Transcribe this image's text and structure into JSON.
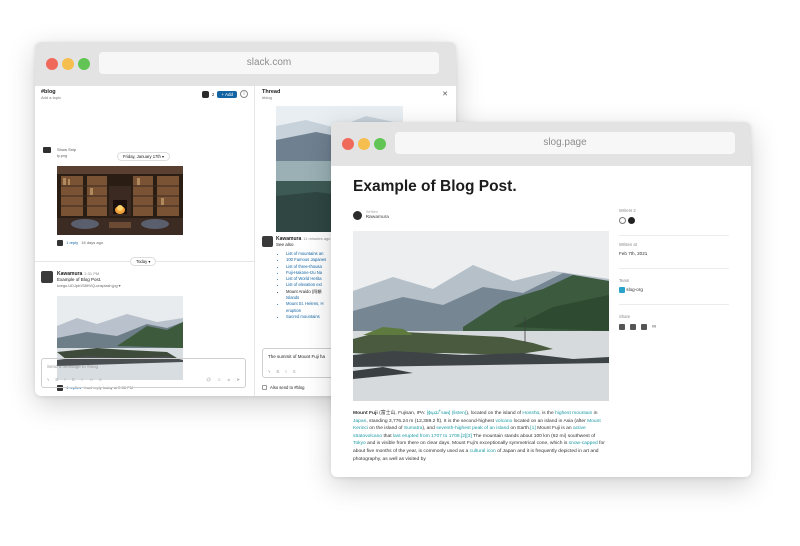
{
  "slack_window": {
    "url": "slack.com",
    "channel": {
      "name": "#blog",
      "topic": "Add a topic",
      "member_count": "2",
      "add_label": "+ Add"
    },
    "messages": {
      "prev_snippet": "Show Snip",
      "prev_file": "ty.png",
      "day_divider_1": "Friday, January 17th",
      "reply_1": "1 reply",
      "reply_1_time": "16 days ago",
      "day_divider_2": "Today",
      "kawamura": {
        "user": "Kawamura",
        "time": "2:31 PM",
        "text": "Example of Blog Post.",
        "file": "kvegu-UDJpb1S8HVQ-unsplash.jpg",
        "replies": "4 replies",
        "last_reply": "Last reply today at 2:38 PM"
      }
    },
    "composer_placeholder": "Send a message to #blog",
    "thread": {
      "title": "Thread",
      "channel": "#blog",
      "reply_user": "Kawamura",
      "reply_time": "11 minutes ago",
      "see_also": "See also",
      "items": [
        "List of mountains an",
        "100 Famous Japanes",
        "List of three-thousa",
        "Fuji-Hakone-Izu Na",
        "List of World Herita",
        "List of elevation ext",
        "Mount Araido (阿頼",
        "Islands",
        "Mount St. Helens, H",
        "eruption",
        "Sacred mountains"
      ],
      "composer_text": "The summit of Mount Fuji ha",
      "also_send": "Also send to #blog"
    }
  },
  "blog_window": {
    "url": "slog.page",
    "title": "Example of Blog Post.",
    "author_label": "Written by",
    "author_name": "Kawamura",
    "body": {
      "p1": "Mount Fuji",
      "p1_jp": " (富士山, Fujisan, IPA: ",
      "ipa": "[ɸɯ̥ʑiꜜsaɴ] (listen)",
      "p1b": "), located on the island of ",
      "honshu": "Honshū",
      "p1c": ", is the ",
      "highest_mountain": "highest mountain",
      "p1d": " in ",
      "japan": "Japan",
      "p1e": ", standing 3,776.24 m (12,389.2 ft). It is the second-highest ",
      "volcano": "volcano",
      "p1f": " located on an island in Asia (after ",
      "kerinci": "Mount Kerinci",
      "p1g": " on the island of ",
      "sumatra": "Sumatra",
      "p1h": "), and ",
      "seventh": "seventh-highest peak of an island",
      "p1i": " on Earth.",
      "ref1": "[1]",
      "p1j": " Mount Fuji is an ",
      "active": "active stratovolcano",
      "p1k": " that ",
      "erupted": "last erupted from 1707 to 1708",
      "refs": ".[2][3]",
      "p1l": " The mountain stands about 100 km (62 mi) southwest of ",
      "tokyo": "Tokyo",
      "p1m": " and is visible from there on clear days. Mount Fuji's exceptionally symmetrical cone, which is ",
      "snow": "snow-capped",
      "p1n": " for about five months of the year, is commonly used as a ",
      "cultural": "cultural icon",
      "p1o": " of Japan and it is frequently depicted in art and photography, as well as visited by"
    },
    "sidebar": {
      "writers_label": "Writers",
      "writers_count": "2",
      "written_at_label": "Written at",
      "written_at": "Feb 7th, 2021",
      "team_label": "Team",
      "team": "slog-org",
      "share_label": "Share"
    }
  },
  "colors": {
    "link_slack": "#1264a3",
    "link_blog": "#1a9aa3",
    "dot_red": "#ef6a5a",
    "dot_yellow": "#f4bf4f",
    "dot_green": "#61c454"
  }
}
